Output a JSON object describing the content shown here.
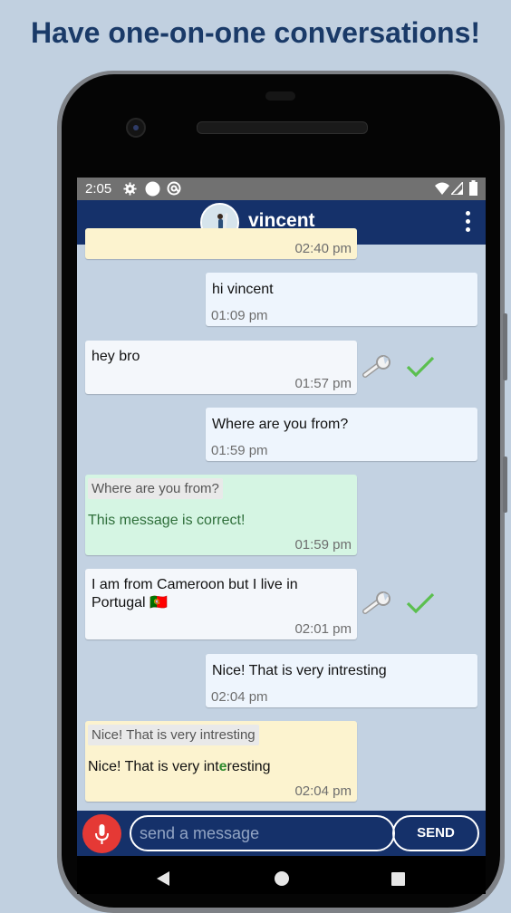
{
  "headline": "Have one-on-one conversations!",
  "status_bar": {
    "time": "2:05"
  },
  "app_bar": {
    "title": "vincent"
  },
  "messages": [
    {
      "id": "m0",
      "direction": "incoming",
      "time": "02:40 pm",
      "partial": true
    },
    {
      "id": "m1",
      "direction": "outgoing",
      "text": "hi vincent",
      "time": "01:09 pm"
    },
    {
      "id": "m2",
      "direction": "incoming",
      "text": "hey bro",
      "time": "01:57 pm"
    },
    {
      "id": "m3",
      "direction": "outgoing",
      "text": "Where are you from?",
      "time": "01:59 pm"
    },
    {
      "id": "m4",
      "direction": "incoming",
      "type": "correction",
      "quoted": "Where are you from?",
      "text": "This message is correct!",
      "time": "01:59 pm"
    },
    {
      "id": "m5",
      "direction": "incoming",
      "text": "I am from Cameroon but I live in Portugal 🇵🇹",
      "time": "02:01 pm"
    },
    {
      "id": "m6",
      "direction": "outgoing",
      "text": "Nice! That is very intresting",
      "time": "02:04 pm"
    },
    {
      "id": "m7",
      "direction": "incoming",
      "type": "correction",
      "quoted": "Nice! That is very intresting",
      "text_before": "Nice! That is very int",
      "text_inserted": "e",
      "text_after": "resting",
      "time": "02:04 pm"
    }
  ],
  "input": {
    "placeholder": "send a message",
    "send_label": "SEND"
  },
  "colors": {
    "background": "#c1d0e0",
    "app_bar": "#15316a",
    "correct_bubble": "#d5f5e3",
    "corrected_bubble": "#fcf3cf",
    "check": "#5bbf4f",
    "mic": "#e53935",
    "insertion": "#2e8b2e"
  },
  "icons": [
    "settings-gear-icon",
    "circle-icon",
    "at-sign-icon",
    "wifi-icon",
    "signal-icon",
    "battery-icon",
    "more-vertical-icon",
    "wrench-icon",
    "checkmark-icon",
    "microphone-icon",
    "back-icon",
    "home-icon",
    "recents-icon"
  ]
}
